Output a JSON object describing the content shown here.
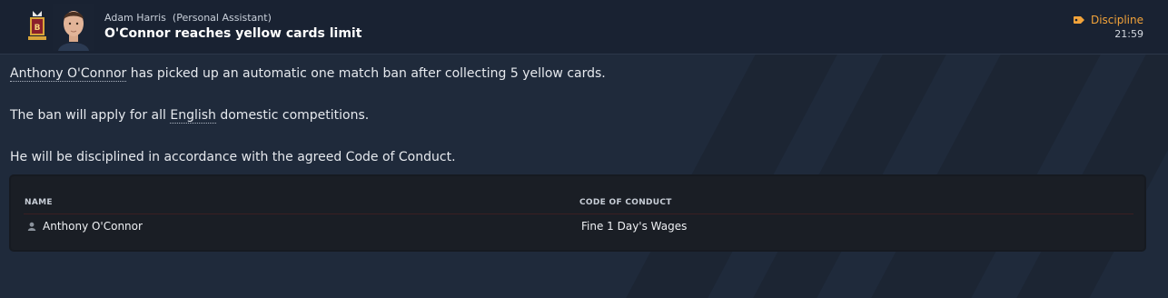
{
  "message": {
    "sender_name": "Adam Harris",
    "sender_role": "(Personal Assistant)",
    "subject": "O'Connor reaches yellow cards limit",
    "category": "Discipline",
    "time": "21:59",
    "crest_icon": "club-crest",
    "avatar_icon": "staff-portrait"
  },
  "body": {
    "p1_link": "Anthony O'Connor",
    "p1_rest": " has picked up an automatic one match ban after collecting 5 yellow cards.",
    "p2_before": "The ban will apply for all ",
    "p2_link": "English",
    "p2_after": " domestic competitions.",
    "p3": "He will be disciplined in accordance with the agreed Code of Conduct."
  },
  "table": {
    "columns": [
      "NAME",
      "CODE OF CONDUCT"
    ],
    "rows": [
      {
        "name": "Anthony O'Connor",
        "conduct": "Fine 1 Day's Wages",
        "icon": "person-icon"
      }
    ]
  },
  "colors": {
    "accent": "#f2a33a",
    "background": "#1f2a3b",
    "header": "#192232",
    "table": "#1a1e25"
  }
}
